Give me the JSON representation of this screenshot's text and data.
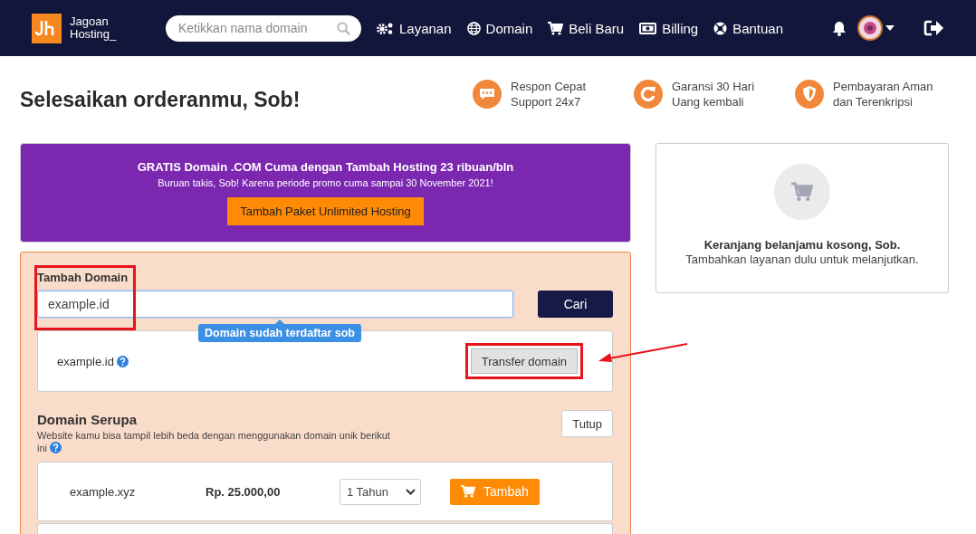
{
  "navbar": {
    "logo_lines": [
      "Jagoan",
      "Hosting_"
    ],
    "search": {
      "placeholder": "Ketikkan nama domain"
    },
    "menu": [
      {
        "kind": "gears",
        "label": "Layanan"
      },
      {
        "kind": "globe",
        "label": "Domain"
      },
      {
        "kind": "cart",
        "label": "Beli Baru"
      },
      {
        "kind": "bill",
        "label": "Billing"
      },
      {
        "kind": "lifebuoy",
        "label": "Bantuan"
      }
    ]
  },
  "page_title": "Selesaikan orderanmu, Sob!",
  "features": [
    {
      "kind": "chat",
      "lines": [
        "Respon Cepat",
        "Support 24x7"
      ]
    },
    {
      "kind": "refresh",
      "lines": [
        "Garansi 30 Hari",
        "Uang kembali"
      ]
    },
    {
      "kind": "shield",
      "lines": [
        "Pembayaran Aman",
        "dan Terenkripsi"
      ]
    }
  ],
  "promo": {
    "headline": "GRATIS Domain .COM Cuma dengan Tambah Hosting 23 ribuan/bln",
    "subline": "Buruan takis, Sob! Karena periode promo cuma sampai 30 November 2021!",
    "button": "Tambah Paket Unlimited Hosting"
  },
  "domain_search": {
    "label": "Tambah Domain",
    "value": "example.id",
    "button": "Cari",
    "tooltip": "Domain sudah terdaftar sob",
    "highlighted": true
  },
  "result": {
    "domain": "example.id",
    "button": "Transfer domain",
    "highlighted": true
  },
  "similar": {
    "title": "Domain Serupa",
    "description": "Website kamu bisa tampil lebih beda dengan menggunakan domain unik berikut ini",
    "close_button": "Tutup",
    "items": [
      {
        "domain": "example.xyz",
        "price": "Rp. 25.000,00",
        "period": "1 Tahun",
        "button": "Tambah"
      }
    ]
  },
  "cart": {
    "title": "Keranjang belanjamu kosong, Sob.",
    "message": "Tambahkan layanan dulu untuk melanjutkan."
  }
}
